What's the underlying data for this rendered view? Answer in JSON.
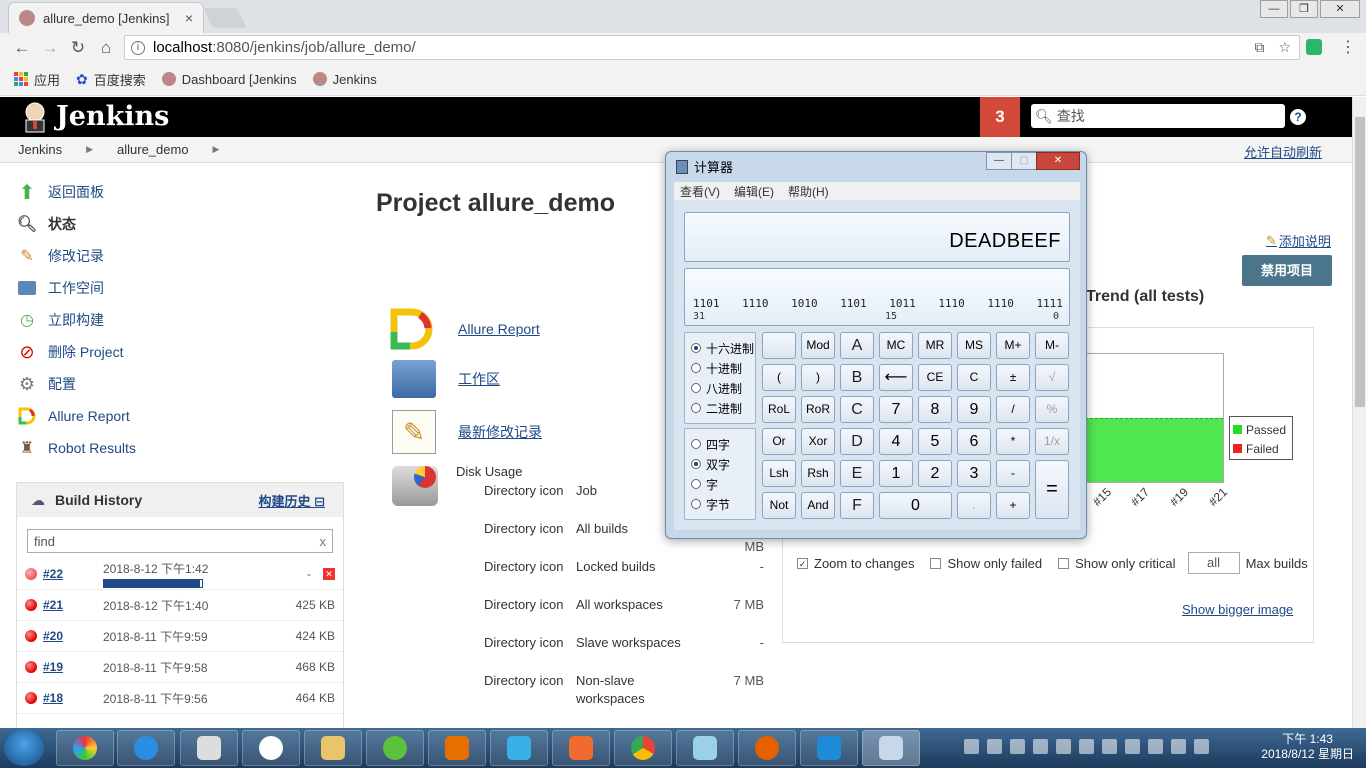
{
  "browser": {
    "tab_title": "allure_demo [Jenkins]",
    "tab_close": "×",
    "url_host": "localhost",
    "url_path": ":8080/jenkins/job/allure_demo/",
    "window_buttons": [
      "—",
      "❐",
      "✕"
    ]
  },
  "bookmarks": [
    {
      "label": "应用",
      "icon": "apps-icon"
    },
    {
      "label": "百度搜索",
      "icon": "baidu-icon"
    },
    {
      "label": "Dashboard [Jenkins",
      "icon": "jenkins-icon"
    },
    {
      "label": "Jenkins",
      "icon": "jenkins-icon"
    }
  ],
  "jenkins": {
    "title": "Jenkins",
    "notification_count": "3",
    "search_placeholder": "查找",
    "help": "?",
    "breadcrumbs": [
      "Jenkins",
      "allure_demo"
    ],
    "auto_refresh": "允许自动刷新"
  },
  "sidebar": {
    "items": [
      {
        "label": "返回面板",
        "icon": "up-arrow-icon",
        "color": "#4caf50"
      },
      {
        "label": "状态",
        "icon": "search-icon",
        "bold": true
      },
      {
        "label": "修改记录",
        "icon": "notepad-icon"
      },
      {
        "label": "工作空间",
        "icon": "folder-icon"
      },
      {
        "label": "立即构建",
        "icon": "build-clock-icon"
      },
      {
        "label": "删除 Project",
        "icon": "no-entry-icon"
      },
      {
        "label": "配置",
        "icon": "gear-icon"
      },
      {
        "label": "Allure Report",
        "icon": "allure-icon"
      },
      {
        "label": "Robot Results",
        "icon": "robot-icon"
      }
    ]
  },
  "build_history": {
    "title": "Build History",
    "trend_link": "构建历史",
    "find_value": "find",
    "find_clear": "x",
    "builds": [
      {
        "num": "#22",
        "date": "2018-8-12 下午1:42",
        "size": "-",
        "in_progress": true,
        "progress": 0.98
      },
      {
        "num": "#21",
        "date": "2018-8-12 下午1:40",
        "size": "425 KB"
      },
      {
        "num": "#20",
        "date": "2018-8-11 下午9:59",
        "size": "424 KB"
      },
      {
        "num": "#19",
        "date": "2018-8-11 下午9:58",
        "size": "468 KB"
      },
      {
        "num": "#18",
        "date": "2018-8-11 下午9:56",
        "size": "464 KB"
      }
    ]
  },
  "main": {
    "title": "Project allure_demo",
    "links": [
      {
        "label": "Allure Report",
        "icon": "allure-icon"
      },
      {
        "label": "工作区",
        "icon": "folder-icon"
      },
      {
        "label": "最新修改记录",
        "icon": "notepad-icon"
      }
    ],
    "disk_usage": {
      "title": "Disk Usage",
      "icon_alt": "Directory icon",
      "rows": [
        {
          "name": "Job",
          "size": ""
        },
        {
          "name": "All builds",
          "size": "MB"
        },
        {
          "name": "Locked builds",
          "size": "-"
        },
        {
          "name": "All workspaces",
          "size": "7 MB"
        },
        {
          "name": "Slave workspaces",
          "size": "-"
        },
        {
          "name": "Non-slave workspaces",
          "size": "7 MB"
        }
      ]
    },
    "add_description": "添加说明",
    "disable_button": "禁用项目",
    "trend_title": "Trend (all tests)",
    "trend": {
      "legend": [
        {
          "name": "Passed",
          "color": "#22dd22"
        },
        {
          "name": "Failed",
          "color": "#ee2222"
        }
      ],
      "x_ticks": [
        "#15",
        "#17",
        "#19",
        "#21"
      ],
      "options": [
        {
          "label": "Zoom to changes",
          "checked": true
        },
        {
          "label": "Show only failed",
          "checked": false
        },
        {
          "label": "Show only critical",
          "checked": false
        }
      ],
      "max_builds_value": "all",
      "max_builds_label": "Max builds",
      "bigger_image": "Show bigger image"
    }
  },
  "calculator": {
    "title": "计算器",
    "menu": [
      "查看(V)",
      "编辑(E)",
      "帮助(H)"
    ],
    "display": "DEADBEEF",
    "bits": [
      "1101",
      "1110",
      "1010",
      "1101",
      "1011",
      "1110",
      "1110",
      "1111"
    ],
    "bit_index": [
      "31",
      "15",
      "0"
    ],
    "base_options": [
      {
        "label": "十六进制",
        "checked": true
      },
      {
        "label": "十进制",
        "checked": false
      },
      {
        "label": "八进制",
        "checked": false
      },
      {
        "label": "二进制",
        "checked": false
      }
    ],
    "word_options": [
      {
        "label": "四字",
        "checked": false
      },
      {
        "label": "双字",
        "checked": true
      },
      {
        "label": "字",
        "checked": false
      },
      {
        "label": "字节",
        "checked": false
      }
    ],
    "keys": [
      [
        "",
        "Mod",
        "A",
        "MC",
        "MR",
        "MS",
        "M+",
        "M-"
      ],
      [
        "(",
        ")",
        "B",
        "⟵",
        "CE",
        "C",
        "±",
        "√"
      ],
      [
        "RoL",
        "RoR",
        "C",
        "7",
        "8",
        "9",
        "/",
        "%"
      ],
      [
        "Or",
        "Xor",
        "D",
        "4",
        "5",
        "6",
        "*",
        "1/x"
      ],
      [
        "Lsh",
        "Rsh",
        "E",
        "1",
        "2",
        "3",
        "-",
        "="
      ],
      [
        "Not",
        "And",
        "F",
        "0",
        ".",
        "+"
      ]
    ]
  },
  "taskbar": {
    "time": "下午 1:43",
    "date": "2018/8/12 星期日"
  }
}
